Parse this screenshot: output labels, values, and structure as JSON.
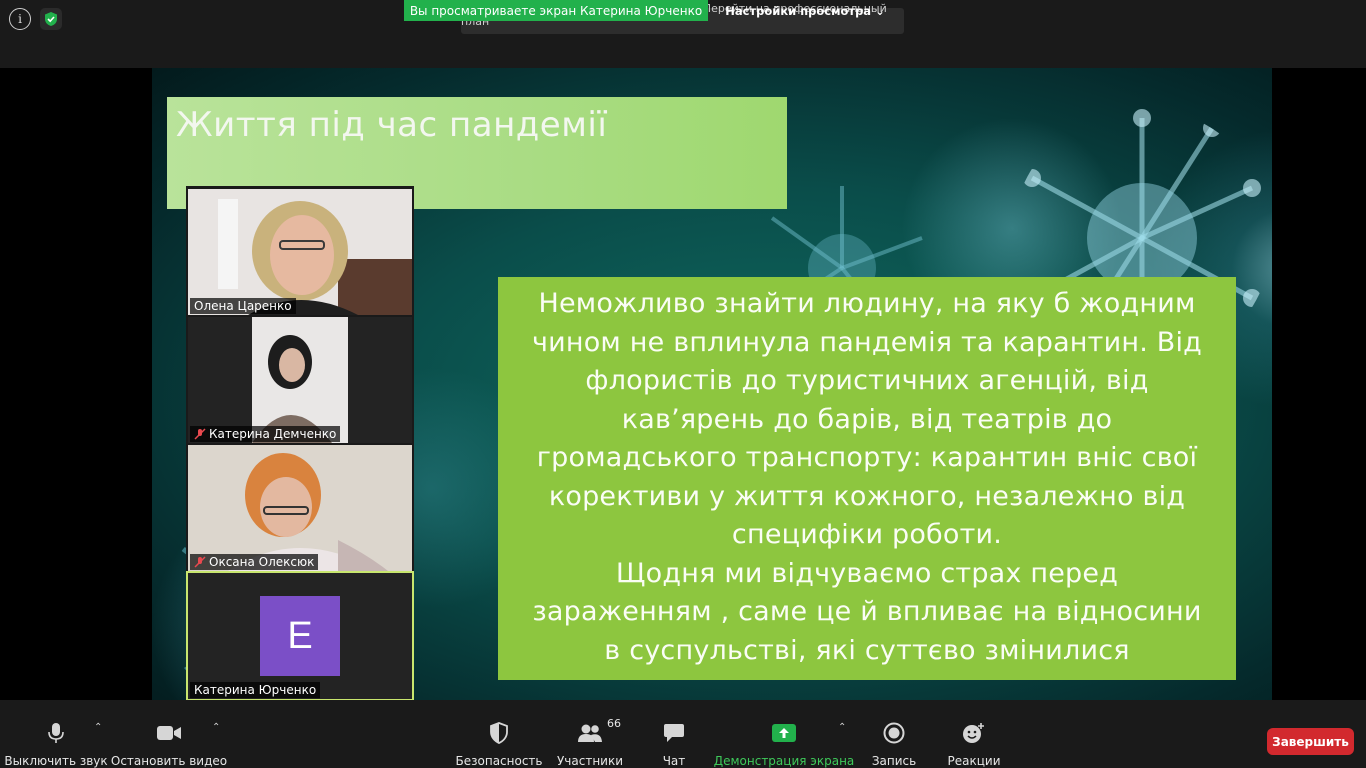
{
  "top": {
    "share_banner": "Вы просматриваете экран Катерина Юрченко",
    "view_options": "Настройки просмотра",
    "time_strip": "Оставшееся время конференции: 07:52 | Перейти на профессиональный план"
  },
  "slide": {
    "title": "Життя під час пандемії",
    "text": "Неможливо знайти людину, на яку б жодним\nчином не вплинула пандемія та карантин. Від\nфлористів до туристичних агенцій, від\nкав’ярень до барів, від театрів до\nгромадського транспорту: карантин вніс свої\nкорективи у життя кожного, незалежно від\nспецифіки роботи.\nЩодня ми відчуваємо страх перед\nзараженням , саме це й впливає на відносини\nв суспульстві, які суттєво змінилися",
    "title_box_color": "#b9e39a",
    "text_box_color": "#8dc63f"
  },
  "participants": [
    {
      "name": "Олена Царенко",
      "muted": false
    },
    {
      "name": "Катерина Демченко",
      "muted": true
    },
    {
      "name": "Оксана Олексюк",
      "muted": true
    },
    {
      "name": "Катерина Юрченко",
      "muted": false,
      "avatar_letter": "E",
      "avatar_color": "#7b4fc7"
    }
  ],
  "toolbar": {
    "mute": "Выключить звук",
    "stop_video": "Остановить видео",
    "security": "Безопасность",
    "participants": "Участники",
    "participants_count": "66",
    "chat": "Чат",
    "share_screen": "Демонстрация экрана",
    "record": "Запись",
    "reactions": "Реакции",
    "end": "Завершить",
    "share_color": "#22b14c",
    "end_color": "#d2292e"
  }
}
